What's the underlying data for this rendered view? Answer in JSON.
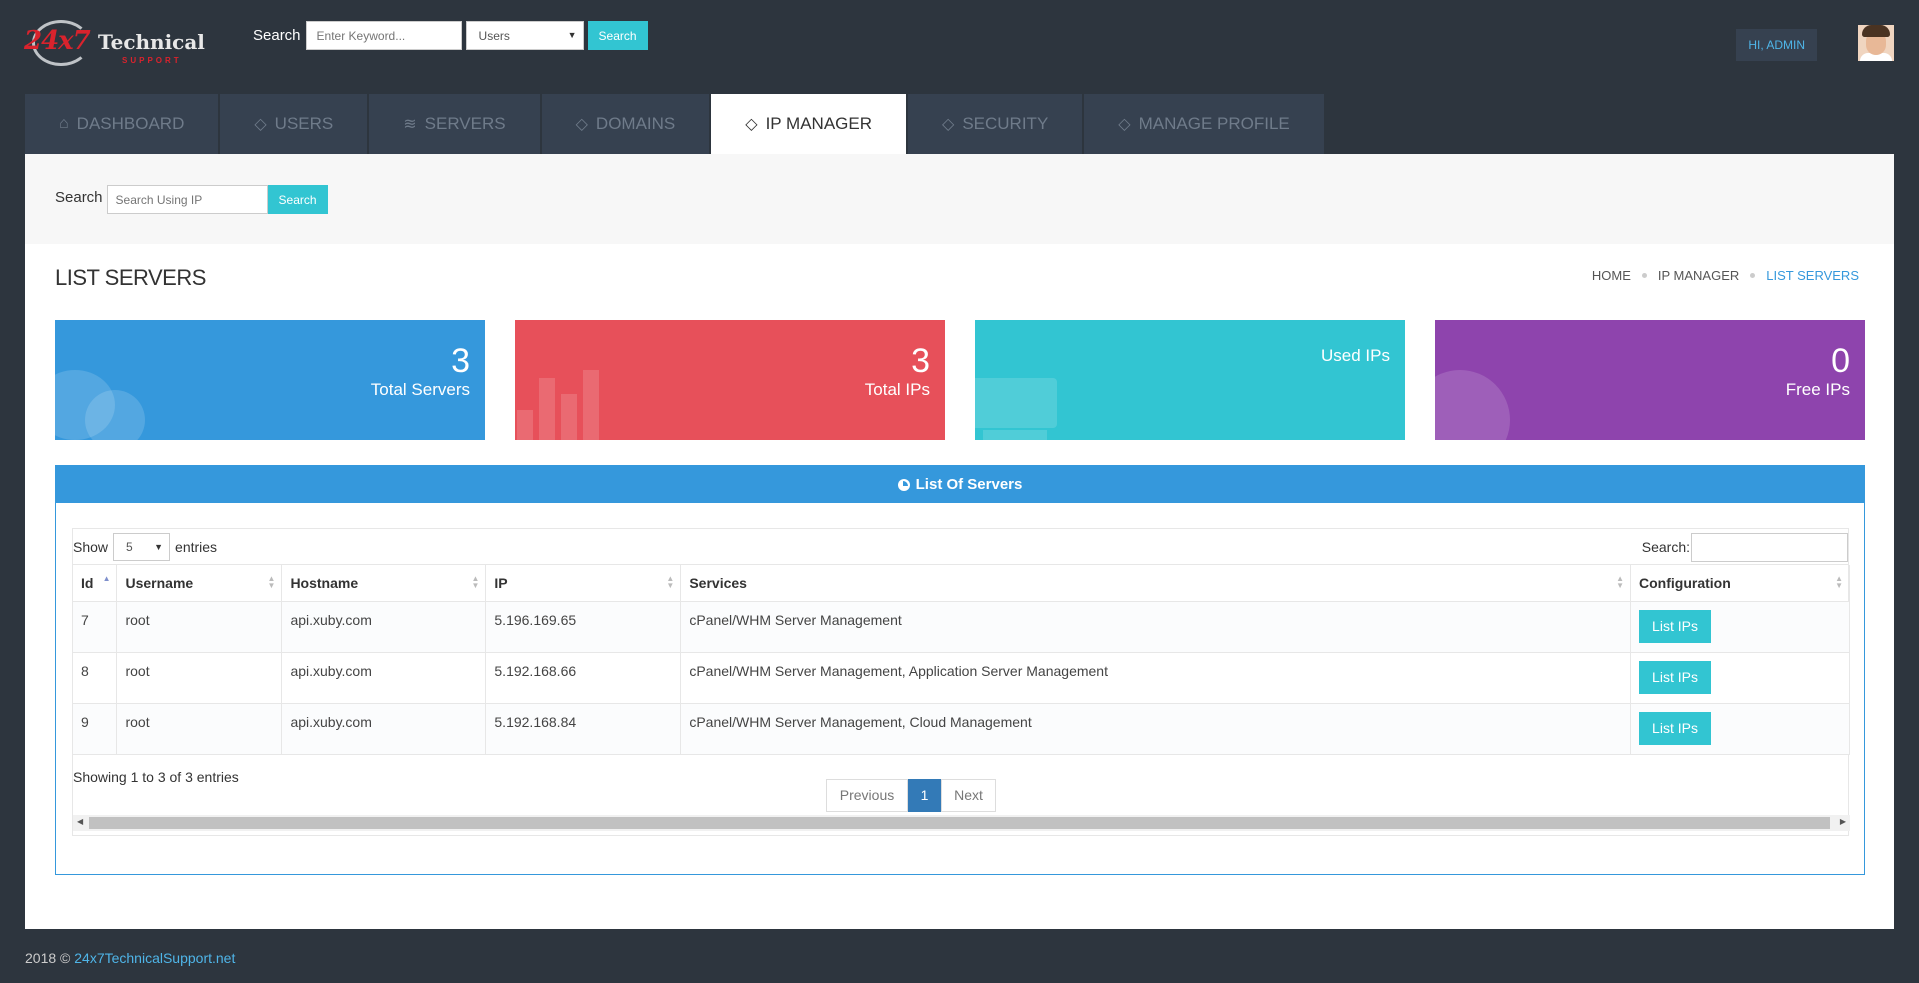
{
  "brand": {
    "logo_num": "24x7",
    "logo_text": "Technical",
    "logo_sub": "SUPPORT"
  },
  "header": {
    "search_label": "Search",
    "search_placeholder": "Enter Keyword...",
    "search_scope": "Users",
    "search_button": "Search",
    "greeting": "HI, ADMIN"
  },
  "tabs": [
    {
      "label": "DASHBOARD",
      "icon": "home-icon"
    },
    {
      "label": "USERS",
      "icon": "tag-icon"
    },
    {
      "label": "SERVERS",
      "icon": "layers-icon"
    },
    {
      "label": "DOMAINS",
      "icon": "tag-icon"
    },
    {
      "label": "IP MANAGER",
      "icon": "tag-icon",
      "active": true
    },
    {
      "label": "SECURITY",
      "icon": "tag-icon"
    },
    {
      "label": "MANAGE PROFILE",
      "icon": "tag-icon"
    }
  ],
  "ip_search": {
    "label": "Search",
    "placeholder": "Search Using IP",
    "button": "Search"
  },
  "page": {
    "title": "LIST SERVERS",
    "breadcrumb": [
      "HOME",
      "IP MANAGER",
      "LIST SERVERS"
    ]
  },
  "stats": [
    {
      "value": "3",
      "label": "Total Servers",
      "color": "#3598dc"
    },
    {
      "value": "3",
      "label": "Total IPs",
      "color": "#e7505a"
    },
    {
      "value": "",
      "label": "Used IPs",
      "color": "#32c5d2"
    },
    {
      "value": "0",
      "label": "Free IPs",
      "color": "#8e44ad"
    }
  ],
  "portlet": {
    "title": "List Of Servers"
  },
  "datatable": {
    "show_label": "Show",
    "page_size": "5",
    "entries_label": "entries",
    "search_label": "Search:",
    "columns": [
      "Id",
      "Username",
      "Hostname",
      "IP",
      "Services",
      "Configuration"
    ],
    "rows": [
      {
        "id": "7",
        "username": "root",
        "hostname": "api.xuby.com",
        "ip": "5.196.169.65",
        "services": "cPanel/WHM Server Management",
        "action": "List IPs"
      },
      {
        "id": "8",
        "username": "root",
        "hostname": "api.xuby.com",
        "ip": "5.192.168.66",
        "services": "cPanel/WHM Server Management, Application Server Management",
        "action": "List IPs"
      },
      {
        "id": "9",
        "username": "root",
        "hostname": "api.xuby.com",
        "ip": "5.192.168.84",
        "services": "cPanel/WHM Server Management, Cloud Management",
        "action": "List IPs"
      }
    ],
    "info": "Showing 1 to 3 of 3 entries",
    "previous": "Previous",
    "current_page": "1",
    "next": "Next"
  },
  "footer": {
    "prefix": "2018 ©",
    "link": "24x7TechnicalSupport.net"
  }
}
